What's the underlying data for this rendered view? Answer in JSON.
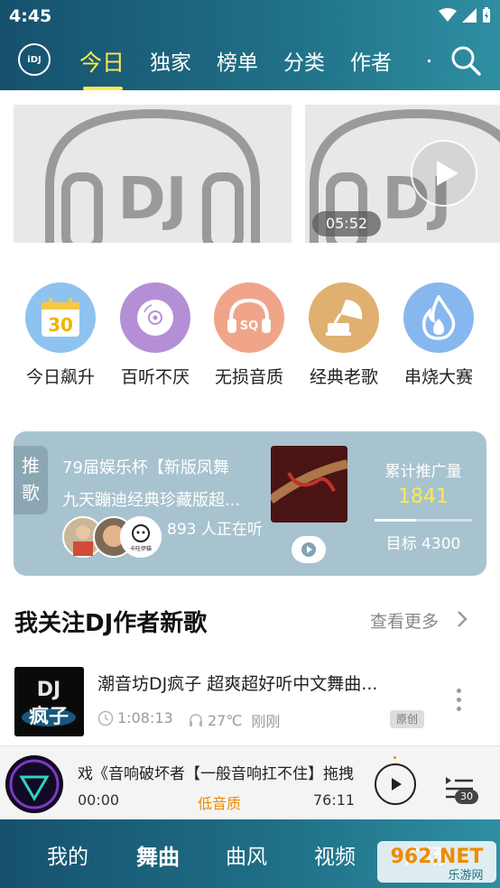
{
  "status_bar": {
    "time": "4:45"
  },
  "header": {
    "logo_text": "iDJ",
    "tabs": [
      {
        "label": "今日",
        "active": true
      },
      {
        "label": "独家"
      },
      {
        "label": "榜单"
      },
      {
        "label": "分类"
      },
      {
        "label": "作者"
      }
    ]
  },
  "banner": {
    "video_duration": "05:52"
  },
  "categories": [
    {
      "label": "今日飙升",
      "icon": "calendar-icon",
      "badge": "30",
      "color": "#8ec3f0"
    },
    {
      "label": "百听不厌",
      "icon": "cd-icon",
      "color": "#b48fd6"
    },
    {
      "label": "无损音质",
      "icon": "sq-headphones-icon",
      "badge": "SQ",
      "color": "#f0a58a"
    },
    {
      "label": "经典老歌",
      "icon": "gramophone-icon",
      "color": "#dfb070"
    },
    {
      "label": "串烧大赛",
      "icon": "flame-icon",
      "color": "#86b8ef"
    }
  ],
  "recommend": {
    "tag": "推歌",
    "title_line1": "79届娱乐杯【新版凤舞",
    "title_line2": "九天蹦迪经典珍藏版超...",
    "listening_count": "893",
    "listening_suffix": "人正在听",
    "stat_label": "累计推广量",
    "stat_value": "1841",
    "target_label": "目标 4300",
    "progress_fraction": 0.428,
    "avatar_caption": "卡哇伊猫"
  },
  "section": {
    "title": "我关注DJ作者新歌",
    "more_label": "查看更多"
  },
  "songs": [
    {
      "title": "潮音坊DJ疯子 超爽超好听中文舞曲...",
      "cover_text_top": "DJ",
      "cover_text_bottom": "疯子",
      "duration": "1:08:13",
      "temperature": "27℃",
      "time_ago": "刚刚",
      "badge": "原创"
    }
  ],
  "player": {
    "title": "戏《音响破坏者【一般音响扛不住】拖拽",
    "current_time": "00:00",
    "quality": "低音质",
    "total_time": "76:11",
    "playlist_count": "30"
  },
  "bottom_nav": [
    {
      "label": "我的"
    },
    {
      "label": "舞曲",
      "active": true
    },
    {
      "label": "曲风"
    },
    {
      "label": "视频"
    },
    {
      "label": "广场"
    }
  ],
  "watermark": {
    "text_top": "962.NET",
    "text_bottom": "乐游网"
  }
}
